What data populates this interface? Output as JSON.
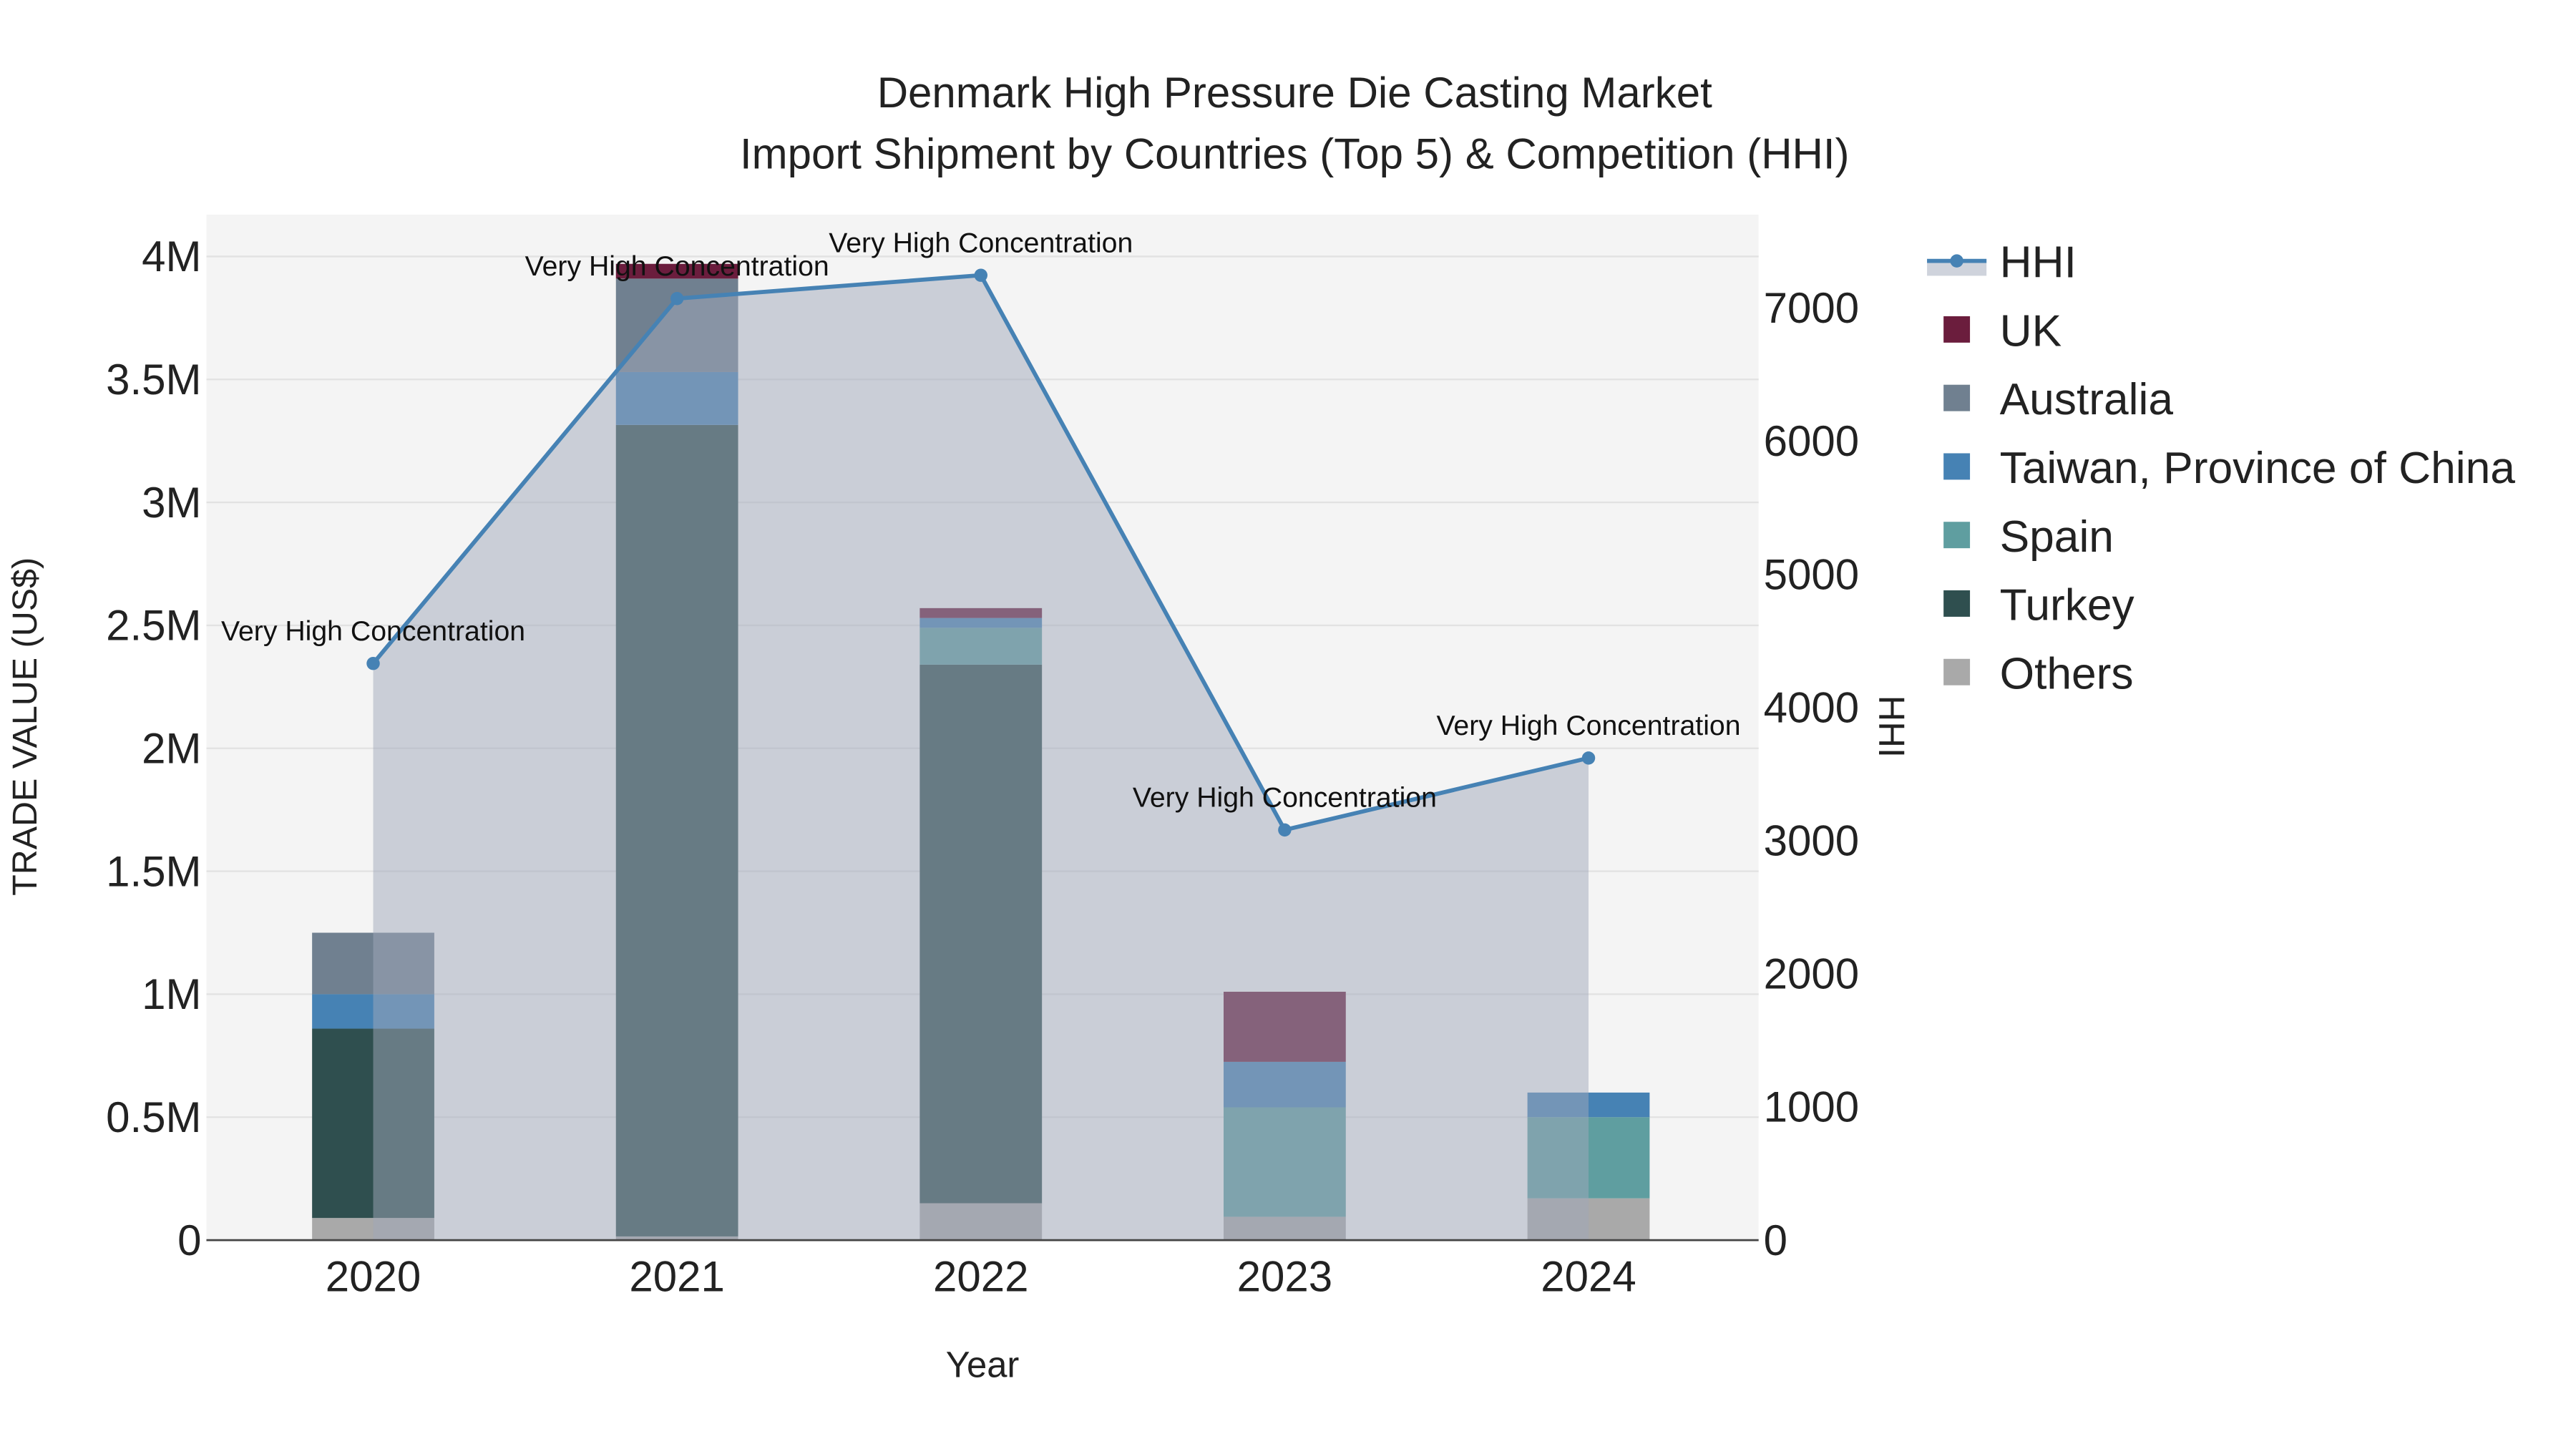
{
  "chart_data": {
    "type": "bar",
    "title": "Denmark High Pressure Die Casting Market",
    "subtitle": "Import Shipment by Countries (Top 5) & Competition (HHI)",
    "xlabel": "Year",
    "ylabel": "TRADE VALUE (US$)",
    "y2label": "HHI",
    "categories": [
      "2020",
      "2021",
      "2022",
      "2023",
      "2024"
    ],
    "ylim": [
      0,
      4170000
    ],
    "y2lim": [
      0,
      7700
    ],
    "yticks": [
      0,
      500000,
      1000000,
      1500000,
      2000000,
      2500000,
      3000000,
      3500000,
      4000000
    ],
    "ytick_labels": [
      "0",
      "0.5M",
      "1M",
      "1.5M",
      "2M",
      "2.5M",
      "3M",
      "3.5M",
      "4M"
    ],
    "y2ticks": [
      0,
      1000,
      2000,
      3000,
      4000,
      5000,
      6000,
      7000
    ],
    "y2tick_labels": [
      "0",
      "1000",
      "2000",
      "3000",
      "4000",
      "5000",
      "6000",
      "7000"
    ],
    "grid": true,
    "legend_placement": "right",
    "stacked": true,
    "series": [
      {
        "name": "Others",
        "color": "#a9a9a9",
        "values": [
          90000,
          15000,
          150000,
          95000,
          170000
        ]
      },
      {
        "name": "Turkey",
        "color": "#2f4f4f",
        "values": [
          770000,
          3300000,
          2190000,
          0,
          0
        ]
      },
      {
        "name": "Spain",
        "color": "#5f9ea0",
        "values": [
          0,
          0,
          150000,
          445000,
          330000
        ]
      },
      {
        "name": "Taiwan, Province of China",
        "color": "#4682b4",
        "values": [
          140000,
          215000,
          40000,
          185000,
          100000
        ]
      },
      {
        "name": "Australia",
        "color": "#708090",
        "values": [
          250000,
          380000,
          0,
          0,
          0
        ]
      },
      {
        "name": "UK",
        "color": "#6b1d3d",
        "values": [
          0,
          60000,
          40000,
          285000,
          0
        ]
      }
    ],
    "legend_order": [
      "HHI",
      "UK",
      "Australia",
      "Taiwan, Province of China",
      "Spain",
      "Turkey",
      "Others"
    ],
    "hhi": {
      "name": "HHI",
      "color": "#4682b4",
      "values": [
        4330,
        7070,
        7245,
        3080,
        3620
      ],
      "annotations": [
        "Very High Concentration",
        "Very High Concentration",
        "Very High Concentration",
        "Very High Concentration",
        "Very High Concentration"
      ]
    }
  }
}
